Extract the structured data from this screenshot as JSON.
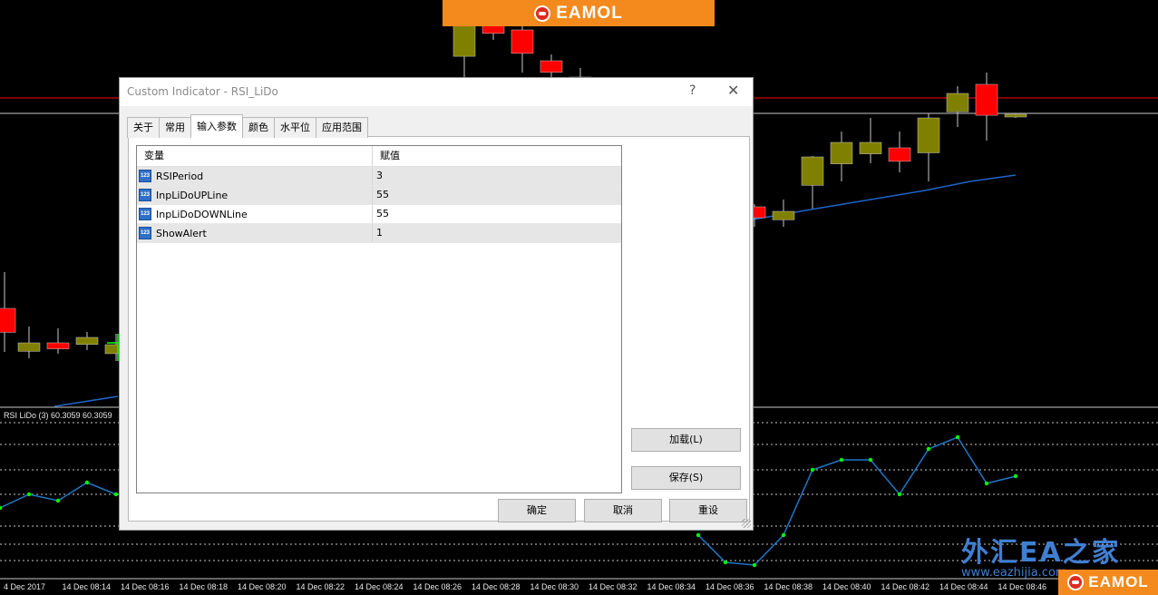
{
  "brand": {
    "name": "EAMOL",
    "bottom_name": "EAMOL"
  },
  "watermark": {
    "cn_text": "外汇EA之家",
    "url": "www.eazhijia.com"
  },
  "indicator_label": "RSI LiDo (3) 60.3059 60.3059",
  "time_axis": [
    "4 Dec 2017",
    "14 Dec 08:14",
    "14 Dec 08:16",
    "14 Dec 08:18",
    "14 Dec 08:20",
    "14 Dec 08:22",
    "14 Dec 08:24",
    "14 Dec 08:26",
    "14 Dec 08:28",
    "14 Dec 08:30",
    "14 Dec 08:32",
    "14 Dec 08:34",
    "14 Dec 08:36",
    "14 Dec 08:38",
    "14 Dec 08:40",
    "14 Dec 08:42",
    "14 Dec 08:44",
    "14 Dec 08:46"
  ],
  "colors": {
    "bull": "#808000",
    "bear": "#ff0000",
    "ma_line": "#1e64c8",
    "rsi_line": "#1e78c8",
    "rsi_point": "#00ff00",
    "level_line": "#ff0000",
    "grid_dots": "#c8c8c8",
    "accent": "#f48a1e"
  },
  "dialog": {
    "title": "Custom Indicator - RSI_LiDo",
    "help_glyph": "?",
    "close_glyph": "✕",
    "tabs": [
      {
        "label": "关于",
        "active": false
      },
      {
        "label": "常用",
        "active": false
      },
      {
        "label": "输入参数",
        "active": true
      },
      {
        "label": "颜色",
        "active": false
      },
      {
        "label": "水平位",
        "active": false
      },
      {
        "label": "应用范围",
        "active": false
      }
    ],
    "grid": {
      "headers": [
        "变量",
        "赋值"
      ],
      "rows": [
        {
          "name": "RSIPeriod",
          "value": "3"
        },
        {
          "name": "InpLiDoUPLine",
          "value": "55"
        },
        {
          "name": "InpLiDoDOWNLine",
          "value": "55"
        },
        {
          "name": "ShowAlert",
          "value": "1"
        }
      ],
      "icon_text": "123"
    },
    "buttons": {
      "load": "加载(L)",
      "save": "保存(S)",
      "ok": "确定",
      "cancel": "取消",
      "reset": "重设"
    }
  }
}
